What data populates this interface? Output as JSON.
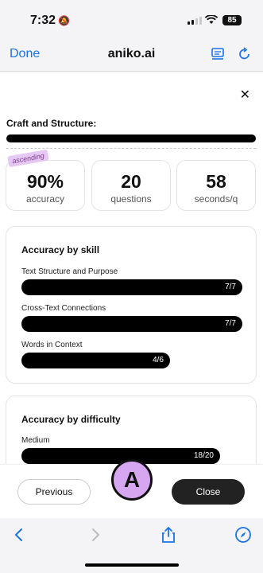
{
  "status": {
    "time": "7:32",
    "battery": "85"
  },
  "header": {
    "done": "Done",
    "title": "aniko.ai"
  },
  "page": {
    "section_title": "Craft and Structure:",
    "tag": "ascending",
    "stats": [
      {
        "value": "90%",
        "label": "accuracy"
      },
      {
        "value": "20",
        "label": "questions"
      },
      {
        "value": "58",
        "label": "seconds/q"
      }
    ],
    "skill_panel": {
      "title": "Accuracy by skill",
      "items": [
        {
          "label": "Text Structure and Purpose",
          "value": "7/7"
        },
        {
          "label": "Cross-Text Connections",
          "value": "7/7"
        },
        {
          "label": "Words in Context",
          "value": "4/6"
        }
      ]
    },
    "difficulty_panel": {
      "title": "Accuracy by difficulty",
      "items": [
        {
          "label": "Medium",
          "value": "18/20"
        }
      ]
    }
  },
  "actions": {
    "previous": "Previous",
    "close": "Close",
    "avatar_letter": "A"
  },
  "colors": {
    "accent": "#1a73e8",
    "avatar": "#d7a6f0",
    "tag_bg": "#e6c9f2"
  }
}
